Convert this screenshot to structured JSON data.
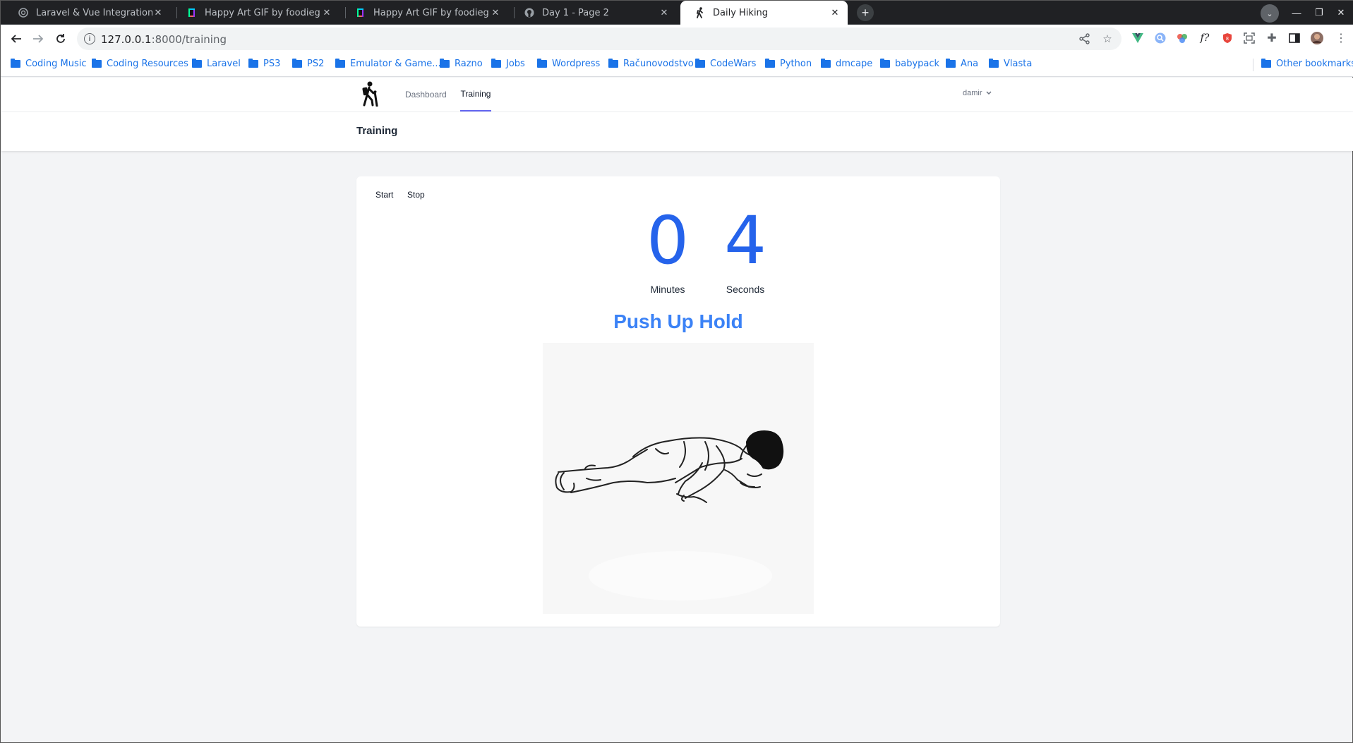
{
  "browser": {
    "tabs": [
      {
        "title": "Laravel & Vue Integration",
        "favicon": "openai-icon"
      },
      {
        "title": "Happy Art GIF by foodieg - Find",
        "favicon": "giphy-icon"
      },
      {
        "title": "Happy Art GIF by foodieg - Find",
        "favicon": "giphy-icon"
      },
      {
        "title": "Day 1 - Page 2",
        "favicon": "github-icon"
      },
      {
        "title": "Daily Hiking",
        "favicon": "hiker-icon"
      }
    ],
    "active_tab_index": 4,
    "url_host": "127.0.0.1",
    "url_path": ":8000/training",
    "bookmarks": [
      "Coding Music",
      "Coding Resources",
      "Laravel",
      "PS3",
      "PS2",
      "Emulator & Game...",
      "Razno",
      "Jobs",
      "Wordpress",
      "Računovodstvo",
      "CodeWars",
      "Python",
      "dmcape",
      "babypack",
      "Ana",
      "Vlasta"
    ],
    "other_bookmarks": "Other bookmarks",
    "accent_color": "#1a73e8"
  },
  "app": {
    "nav": {
      "dashboard": "Dashboard",
      "training": "Training",
      "active": "Training",
      "user": "damir"
    },
    "page_title": "Training",
    "controls": {
      "start": "Start",
      "stop": "Stop"
    },
    "timer": {
      "minutes": "0",
      "seconds": "4",
      "minutes_label": "Minutes",
      "seconds_label": "Seconds",
      "color": "#2563eb"
    },
    "exercise": {
      "name": "Push Up Hold",
      "image": "push-up-illustration",
      "color": "#3b82f6"
    }
  }
}
